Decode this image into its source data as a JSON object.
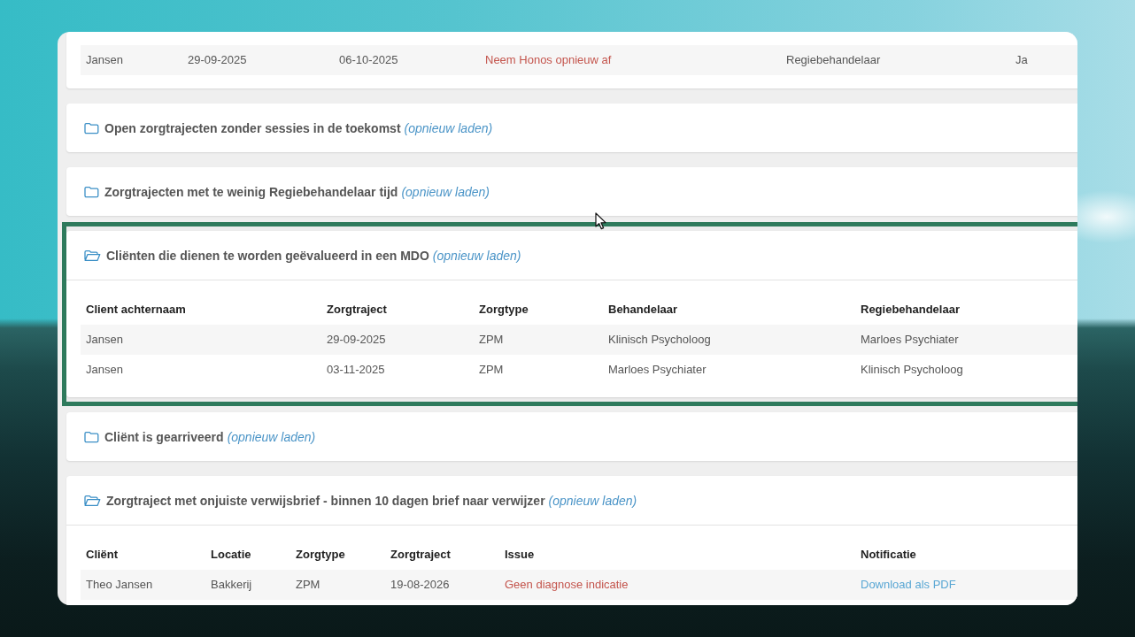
{
  "panels": [
    {
      "highlighted": false,
      "table": {
        "rows": [
          [
            {
              "text": "Jansen",
              "kind": "text"
            },
            {
              "text": "29-09-2025",
              "kind": "text"
            },
            {
              "text": "06-10-2025",
              "kind": "text"
            },
            {
              "text": "Neem Honos opnieuw af",
              "kind": "error"
            },
            {
              "text": "Regiebehandelaar",
              "kind": "text"
            },
            {
              "text": "Ja",
              "kind": "text"
            }
          ]
        ]
      }
    },
    {
      "title": "Open zorgtrajecten zonder sessies in de toekomst",
      "reload": "(opnieuw laden)",
      "expanded": false,
      "highlighted": false
    },
    {
      "title": "Zorgtrajecten met te weinig Regiebehandelaar tijd",
      "reload": "(opnieuw laden)",
      "expanded": false,
      "highlighted": false
    },
    {
      "title": "Cliënten die dienen te worden geëvalueerd in een MDO",
      "reload": "(opnieuw laden)",
      "expanded": true,
      "highlighted": true,
      "table": {
        "columns": [
          "Client achternaam",
          "Zorgtraject",
          "Zorgtype",
          "Behandelaar",
          "Regiebehandelaar"
        ],
        "rows": [
          [
            {
              "text": "Jansen",
              "kind": "text"
            },
            {
              "text": "29-09-2025",
              "kind": "text"
            },
            {
              "text": "ZPM",
              "kind": "text"
            },
            {
              "text": "Klinisch Psycholoog",
              "kind": "text"
            },
            {
              "text": "Marloes Psychiater",
              "kind": "text"
            }
          ],
          [
            {
              "text": "Jansen",
              "kind": "text"
            },
            {
              "text": "03-11-2025",
              "kind": "text"
            },
            {
              "text": "ZPM",
              "kind": "text"
            },
            {
              "text": "Marloes Psychiater",
              "kind": "text"
            },
            {
              "text": "Klinisch Psycholoog",
              "kind": "text"
            }
          ]
        ]
      }
    },
    {
      "title": "Cliënt is gearriveerd",
      "reload": "(opnieuw laden)",
      "expanded": false,
      "highlighted": false
    },
    {
      "title": "Zorgtraject met onjuiste verwijsbrief - binnen 10 dagen brief naar verwijzer",
      "reload": "(opnieuw laden)",
      "expanded": true,
      "highlighted": false,
      "table": {
        "columns": [
          "Cliënt",
          "Locatie",
          "Zorgtype",
          "Zorgtraject",
          "Issue",
          "Notificatie"
        ],
        "rows": [
          [
            {
              "text": "Theo Jansen",
              "kind": "text"
            },
            {
              "text": "Bakkerij",
              "kind": "text"
            },
            {
              "text": "ZPM",
              "kind": "text"
            },
            {
              "text": "19-08-2026",
              "kind": "text"
            },
            {
              "text": "Geen diagnose indicatie",
              "kind": "error"
            },
            {
              "text": "Download als PDF",
              "kind": "link"
            }
          ]
        ]
      }
    }
  ]
}
